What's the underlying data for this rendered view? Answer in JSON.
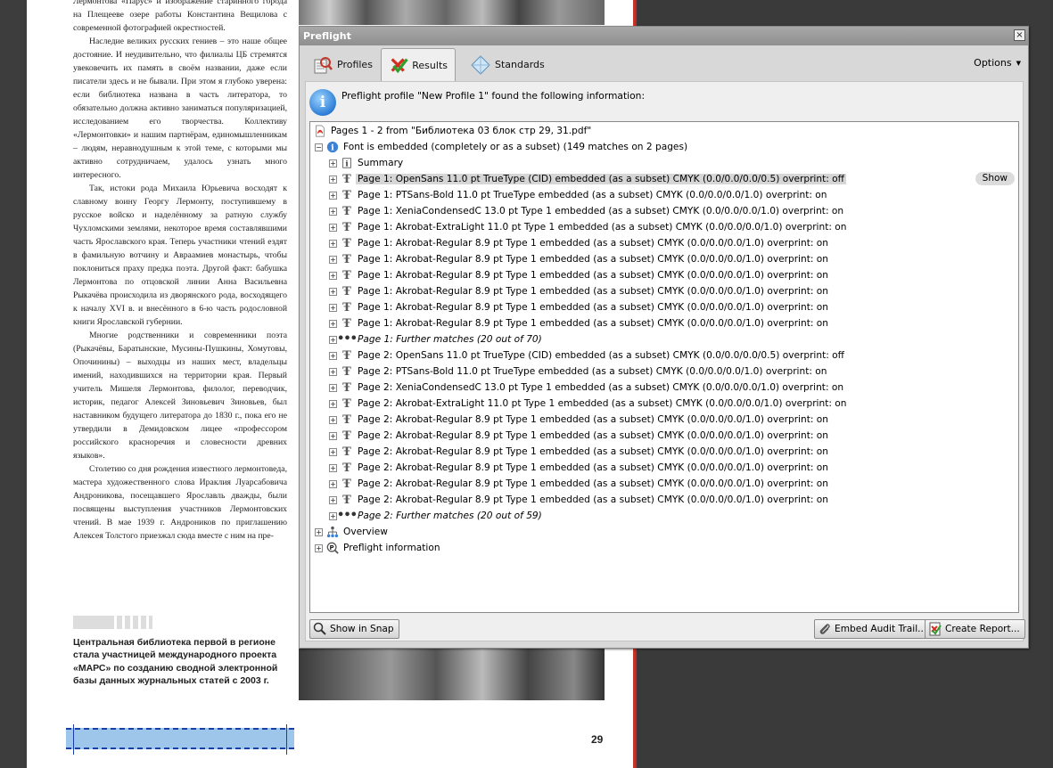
{
  "document": {
    "article_paragraphs": [
      "Лермонтова «Парус» и изображение старинного города на Плещееве озере работы Константина Вещилова с современной фотографией окрестностей.",
      "Наследие великих русских гениев – это наше общее достояние. И неудивительно, что филиалы ЦБ стремятся увековечить их память в своём названии, даже если писатели здесь и не бывали. При этом я глубоко уверена: если библиотека названа в часть литератора, то обязательно должна активно заниматься популяризацией, исследованием его творчества. Коллективу «Лермонтовки» и нашим партнёрам, единомышленникам – людям, неравнодушным к этой теме, с которыми мы активно сотрудничаем, удалось узнать много интересного.",
      "Так, истоки рода Михаила Юрьевича восходят к славному воину Георгу Лермонту, поступившему в русское войско и наделённому за ратную службу Чухломскими землями, некоторое время составлявшими часть Ярославского края. Теперь участники чтений ездят в фамильную вотчину и Авраамиев монастырь, чтобы поклониться праху предка поэта. Другой факт: бабушка Лермонтова по отцовской линии Анна Васильевна Рыкачёва происходила из дворянского рода, восходящего к началу XVI в. и внесённого в 6-ю часть родословной книги Ярославской губернии.",
      "Многие родственники и современники поэта (Рыкачёвы, Баратынские, Мусины-Пушкины, Хомутовы, Опочинины) – выходцы из наших мест, владельцы имений, находившихся на территории края. Первый учитель Мишеля Лермонтова, филолог, переводчик, историк, педагог Алексей Зиновьевич Зиновьев, был наставником будущего литератора до 1830 г., пока его не утвердили в Демидовском лицее «профессором российского красноречия и словесности древних языков».",
      "Столетию со дня рождения известного лермонтоведа, мастера художественного слова Ираклия Луарсабовича Андроникова, посещавшего Ярославль дважды, были посвящены выступления участников Лермонтовских чтений. В мае 1939 г. Андроников по приглашению Алексея Толстого приезжал сюда вместе с ним на пре-"
    ],
    "caption": "Центральная библиотека первой в регионе стала участницей международного проекта «МАРС» по созданию сводной электронной базы данных журнальных статей с 2003 г.",
    "page_number": "29"
  },
  "preflight": {
    "title": "Preflight",
    "close_glyph": "×",
    "tabs": [
      {
        "label": "Profiles",
        "active": false
      },
      {
        "label": "Results",
        "active": true
      },
      {
        "label": "Standards",
        "active": false
      }
    ],
    "options_label": "Options",
    "info_text": "Preflight profile \"New Profile 1\" found the following information:",
    "tree": {
      "root_label": "Pages 1 - 2 from \"Библиотека 03 блок стр 29, 31.pdf\"",
      "font_group_label": "Font is embedded (completely or as a subset) (149 matches on 2 pages)",
      "summary_label": "Summary",
      "rows": [
        "Page 1: OpenSans 11.0 pt TrueType (CID)  embedded (as a subset) CMYK (0.0/0.0/0.0/0.5)  overprint: off",
        "Page 1: PTSans-Bold 11.0 pt TrueType  embedded (as a subset) CMYK (0.0/0.0/0.0/1.0)  overprint: on",
        "Page 1: XeniaCondensedC 13.0 pt Type 1  embedded (as a subset) CMYK (0.0/0.0/0.0/1.0)  overprint: on",
        "Page 1: Akrobat-ExtraLight 11.0 pt Type 1  embedded (as a subset) CMYK (0.0/0.0/0.0/1.0)  overprint: on",
        "Page 1: Akrobat-Regular 8.9 pt Type 1  embedded (as a subset) CMYK (0.0/0.0/0.0/1.0)  overprint: on",
        "Page 1: Akrobat-Regular 8.9 pt Type 1  embedded (as a subset) CMYK (0.0/0.0/0.0/1.0)  overprint: on",
        "Page 1: Akrobat-Regular 8.9 pt Type 1  embedded (as a subset) CMYK (0.0/0.0/0.0/1.0)  overprint: on",
        "Page 1: Akrobat-Regular 8.9 pt Type 1  embedded (as a subset) CMYK (0.0/0.0/0.0/1.0)  overprint: on",
        "Page 1: Akrobat-Regular 8.9 pt Type 1  embedded (as a subset) CMYK (0.0/0.0/0.0/1.0)  overprint: on",
        "Page 1: Akrobat-Regular 8.9 pt Type 1  embedded (as a subset) CMYK (0.0/0.0/0.0/1.0)  overprint: on",
        "Page 1: Further matches (20 out of 70)",
        "Page 2: OpenSans 11.0 pt TrueType (CID)  embedded (as a subset) CMYK (0.0/0.0/0.0/0.5)  overprint: off",
        "Page 2: PTSans-Bold 11.0 pt TrueType  embedded (as a subset) CMYK (0.0/0.0/0.0/1.0)  overprint: on",
        "Page 2: XeniaCondensedC 13.0 pt Type 1  embedded (as a subset) CMYK (0.0/0.0/0.0/1.0)  overprint: on",
        "Page 2: Akrobat-ExtraLight 11.0 pt Type 1  embedded (as a subset) CMYK (0.0/0.0/0.0/1.0)  overprint: on",
        "Page 2: Akrobat-Regular 8.9 pt Type 1  embedded (as a subset) CMYK (0.0/0.0/0.0/1.0)  overprint: on",
        "Page 2: Akrobat-Regular 8.9 pt Type 1  embedded (as a subset) CMYK (0.0/0.0/0.0/1.0)  overprint: on",
        "Page 2: Akrobat-Regular 8.9 pt Type 1  embedded (as a subset) CMYK (0.0/0.0/0.0/1.0)  overprint: on",
        "Page 2: Akrobat-Regular 8.9 pt Type 1  embedded (as a subset) CMYK (0.0/0.0/0.0/1.0)  overprint: on",
        "Page 2: Akrobat-Regular 8.9 pt Type 1  embedded (as a subset) CMYK (0.0/0.0/0.0/1.0)  overprint: on",
        "Page 2: Akrobat-Regular 8.9 pt Type 1  embedded (as a subset) CMYK (0.0/0.0/0.0/1.0)  overprint: on",
        "Page 2: Further matches (20 out of 59)"
      ],
      "overview_label": "Overview",
      "preflight_info_label": "Preflight information",
      "show_button": "Show"
    },
    "buttons": {
      "show_in_snap": "Show in Snap",
      "embed_audit_trail": "Embed Audit Trail...",
      "create_report": "Create Report..."
    }
  }
}
